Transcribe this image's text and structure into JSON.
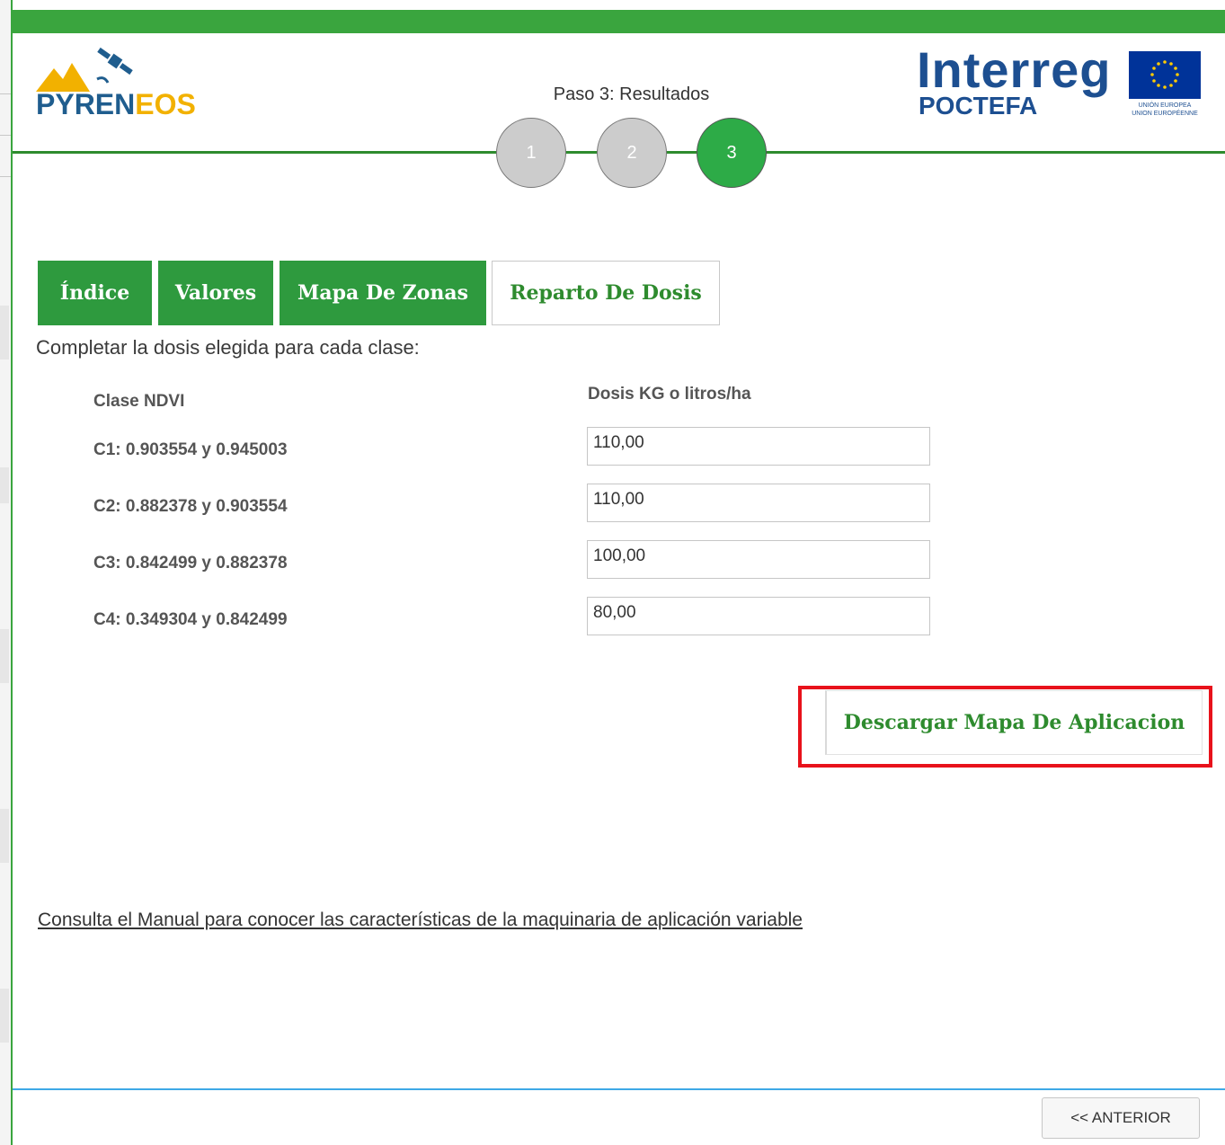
{
  "header": {
    "logo_left": {
      "part1": "PYREN",
      "part2": "EOS"
    },
    "logo_right": {
      "word": "Interreg",
      "sub": "POCTEFA",
      "eu_caption_1": "UNIÓN EUROPEA",
      "eu_caption_2": "UNION EUROPÉENNE"
    },
    "step_title": "Paso 3: Resultados",
    "steps": [
      {
        "label": "1",
        "state": "done"
      },
      {
        "label": "2",
        "state": "done"
      },
      {
        "label": "3",
        "state": "active"
      }
    ]
  },
  "tabs": [
    {
      "label": "Índice",
      "active": false
    },
    {
      "label": "Valores",
      "active": false
    },
    {
      "label": "Mapa De Zonas",
      "active": false
    },
    {
      "label": "Reparto De Dosis",
      "active": true
    }
  ],
  "form": {
    "instruction": "Completar la dosis elegida para cada clase:",
    "col_class": "Clase NDVI",
    "col_dose": "Dosis KG o litros/ha",
    "rows": [
      {
        "label": "C1: 0.903554 y 0.945003",
        "value": "110,00"
      },
      {
        "label": "C2: 0.882378 y 0.903554",
        "value": "110,00"
      },
      {
        "label": "C3: 0.842499 y 0.882378",
        "value": "100,00"
      },
      {
        "label": "C4: 0.349304 y 0.842499",
        "value": "80,00"
      }
    ]
  },
  "download_button": "Descargar Mapa De Aplicacion",
  "manual_link": "Consulta el Manual para conocer las características de la maquinaria de aplicación variable",
  "prev_button": "<< ANTERIOR",
  "colors": {
    "accent_green": "#2e9a3e",
    "step_active": "#2dab47",
    "highlight_red": "#e8121b",
    "footer_blue": "#3ea9e6"
  }
}
